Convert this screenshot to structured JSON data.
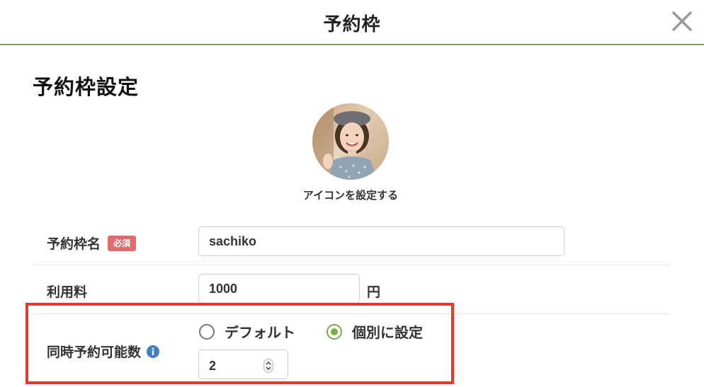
{
  "header": {
    "title": "予約枠"
  },
  "section": {
    "title": "予約枠設定"
  },
  "avatar": {
    "caption": "アイコンを設定する"
  },
  "form": {
    "name": {
      "label": "予約枠名",
      "required_badge": "必須",
      "value": "sachiko"
    },
    "fee": {
      "label": "利用料",
      "value": "1000",
      "unit": "円"
    },
    "concurrent": {
      "label": "同時予約可能数",
      "options": [
        {
          "label": "デフォルト",
          "selected": false
        },
        {
          "label": "個別に設定",
          "selected": true
        }
      ],
      "value": "2"
    }
  },
  "colors": {
    "accent": "#79a84e",
    "required": "#e06b6b",
    "highlight": "#e23a28",
    "info": "#3f7fbf"
  }
}
